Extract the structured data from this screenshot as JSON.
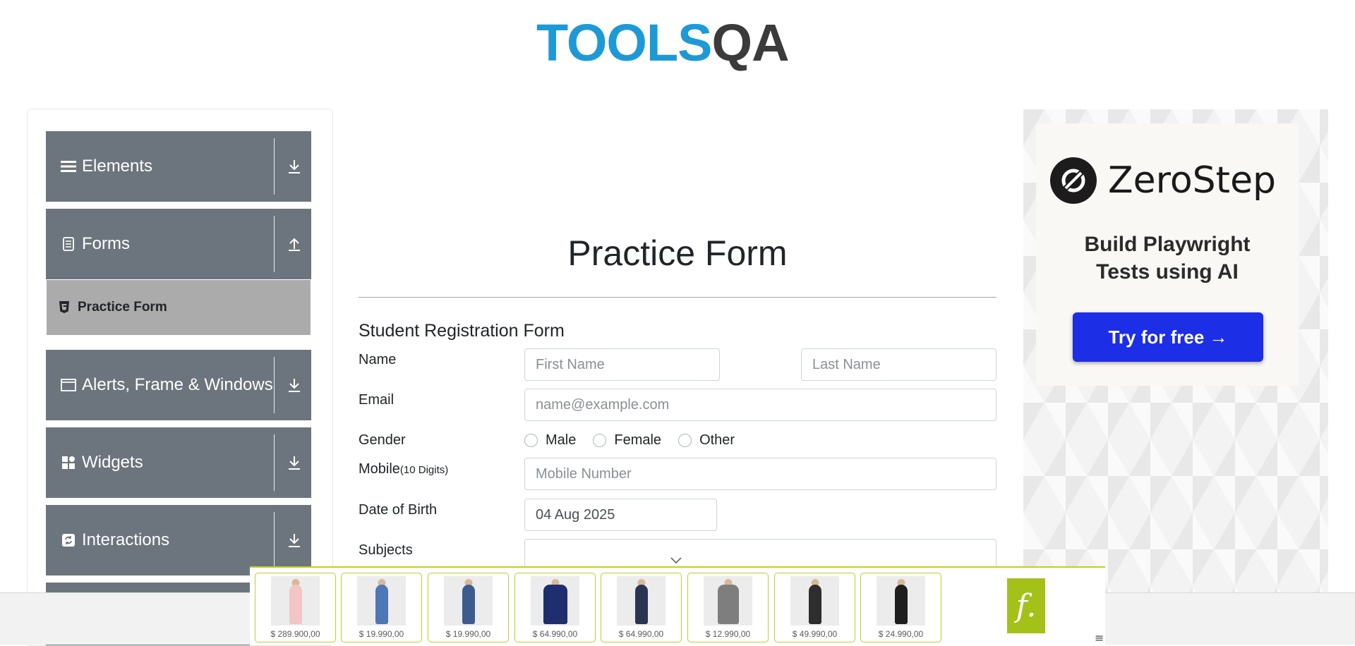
{
  "header": {
    "logo_part1": "TOOLS",
    "logo_part2": "QA"
  },
  "sidebar": {
    "groups": [
      {
        "label": "Elements",
        "icon": "hamburger-icon",
        "arrow": "download-arrow-icon"
      },
      {
        "label": "Forms",
        "icon": "document-icon",
        "arrow": "upload-arrow-icon",
        "items": [
          {
            "label": "Practice Form",
            "icon": "html5-icon"
          }
        ]
      },
      {
        "label": "Alerts, Frame & Windows",
        "icon": "window-icon",
        "arrow": "download-arrow-icon"
      },
      {
        "label": "Widgets",
        "icon": "grid-icon",
        "arrow": "download-arrow-icon"
      },
      {
        "label": "Interactions",
        "icon": "refresh-icon",
        "arrow": "download-arrow-icon"
      }
    ]
  },
  "form": {
    "page_title": "Practice Form",
    "heading": "Student Registration Form",
    "name_label": "Name",
    "first_name_placeholder": "First Name",
    "last_name_placeholder": "Last Name",
    "email_label": "Email",
    "email_placeholder": "name@example.com",
    "gender_label": "Gender",
    "gender_options": [
      "Male",
      "Female",
      "Other"
    ],
    "mobile_label": "Mobile",
    "mobile_hint": "(10 Digits)",
    "mobile_placeholder": "Mobile Number",
    "dob_label": "Date of Birth",
    "dob_value": "04 Aug 2025",
    "subjects_label": "Subjects"
  },
  "ad": {
    "brand": "ZeroStep",
    "tagline_line1": "Build Playwright",
    "tagline_line2": "Tests using AI",
    "cta": "Try for free →"
  },
  "bottom_ad": {
    "products": [
      {
        "price": "$ 289.900,00"
      },
      {
        "price": "$ 19.990,00"
      },
      {
        "price": "$ 19.990,00"
      },
      {
        "price": "$ 64.990,00"
      },
      {
        "price": "$ 64.990,00"
      },
      {
        "price": "$ 12.990,00"
      },
      {
        "price": "$ 49.990,00"
      },
      {
        "price": "$ 24.990,00"
      }
    ],
    "logo_letter": "f.",
    "menu_glyph": "≡"
  },
  "colors": {
    "sidebar_bg": "#6c757d",
    "active_item_bg": "#ababab",
    "logo_blue": "#1d9ad6",
    "cta_blue": "#1c2ee6",
    "bottom_accent": "#a4c11a"
  }
}
